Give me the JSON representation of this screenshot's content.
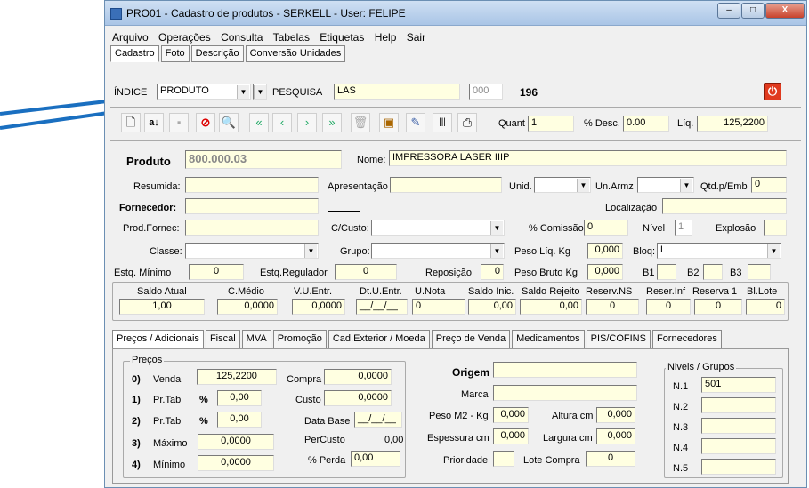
{
  "window": {
    "title": "PRO01 - Cadastro de produtos - SERKELL - User: FELIPE",
    "min": "–",
    "max": "□",
    "close": "X"
  },
  "menu": [
    "Arquivo",
    "Operações",
    "Consulta",
    "Tabelas",
    "Etiquetas",
    "Help",
    "Sair"
  ],
  "tabs_top": [
    "Cadastro",
    "Foto",
    "Descrição",
    "Conversão Unidades"
  ],
  "search": {
    "indice_label": "ÍNDICE",
    "indice_value": "PRODUTO",
    "pesquisa_label": "PESQUISA",
    "pesquisa_value": "LAS",
    "count_field": "000",
    "count": "196"
  },
  "toolbar": {
    "quant_label": "Quant",
    "quant_value": "1",
    "desc_label": "% Desc.",
    "desc_value": "0.00",
    "liq_label": "Líq.",
    "liq_value": "125,2200"
  },
  "product": {
    "produto_label": "Produto",
    "produto_value": "800.000.03",
    "nome_label": "Nome:",
    "nome_value": "IMPRESSORA LASER IIIP",
    "resumida_label": "Resumida:",
    "apresentacao_label": "Apresentação",
    "unid_label": "Unid.",
    "unarmz_label": "Un.Armz",
    "qtdemb_label": "Qtd.p/Emb",
    "qtdemb_value": "0",
    "fornecedor_label": "Fornecedor:",
    "localizacao_label": "Localização",
    "prodfornec_label": "Prod.Fornec:",
    "ccusto_label": "C/Custo:",
    "comissao_label": "% Comissão",
    "comissao_value": "0",
    "nivel_label": "Nível",
    "nivel_value": "1",
    "explosao_label": "Explosão",
    "classe_label": "Classe:",
    "grupo_label": "Grupo:",
    "pesoliq_label": "Peso Líq. Kg",
    "pesoliq_value": "0,000",
    "bloq_label": "Bloq:",
    "bloq_value": "L",
    "estqmin_label": "Estq. Mínimo",
    "estqmin_value": "0",
    "estqreg_label": "Estq.Regulador",
    "estqreg_value": "0",
    "reposicao_label": "Reposição",
    "reposicao_value": "0",
    "pesobruto_label": "Peso Bruto Kg",
    "pesobruto_value": "0,000",
    "b1": "B1",
    "b2": "B2",
    "b3": "B3"
  },
  "stock": {
    "headers": [
      "Saldo Atual",
      "C.Médio",
      "V.U.Entr.",
      "Dt.U.Entr.",
      "U.Nota",
      "Saldo Inic.",
      "Saldo Rejeito",
      "Reserv.NS",
      "Reser.Inf",
      "Reserva 1",
      "Bl.Lote"
    ],
    "values": [
      "1,00",
      "0,0000",
      "0,0000",
      "__/__/__",
      "0",
      "0,00",
      "0,00",
      "0",
      "0",
      "0",
      "0"
    ]
  },
  "tabs_bottom": [
    "Preços / Adicionais",
    "Fiscal",
    "MVA",
    "Promoção",
    "Cad.Exterior / Moeda",
    "Preço de Venda",
    "Medicamentos",
    "PIS/COFINS",
    "Fornecedores"
  ],
  "precos": {
    "group": "Preços",
    "rows": [
      {
        "num": "0)",
        "label": "Venda",
        "pct": "",
        "value": "125,2200"
      },
      {
        "num": "1)",
        "label": "Pr.Tab",
        "pct": "%",
        "value": "0,00"
      },
      {
        "num": "2)",
        "label": "Pr.Tab",
        "pct": "%",
        "value": "0,00"
      },
      {
        "num": "3)",
        "label": "Máximo",
        "pct": "",
        "value": "0,0000"
      },
      {
        "num": "4)",
        "label": "Mínimo",
        "pct": "",
        "value": "0,0000"
      }
    ],
    "compra_label": "Compra",
    "compra_value": "0,0000",
    "custo_label": "Custo",
    "custo_value": "0,0000",
    "database_label": "Data Base",
    "database_value": "__/__/__",
    "percusto_label": "PerCusto",
    "percusto_value": "0,00",
    "perda_label": "% Perda",
    "perda_value": "0,00"
  },
  "origem": {
    "origem_label": "Origem",
    "marca_label": "Marca",
    "pesom2_label": "Peso M2 - Kg",
    "pesom2_value": "0,000",
    "altura_label": "Altura cm",
    "altura_value": "0,000",
    "espessura_label": "Espessura cm",
    "espessura_value": "0,000",
    "largura_label": "Largura cm",
    "largura_value": "0,000",
    "prioridade_label": "Prioridade",
    "lotecompra_label": "Lote Compra",
    "lotecompra_value": "0"
  },
  "niveis": {
    "group": "Niveis / Grupos",
    "labels": [
      "N.1",
      "N.2",
      "N.3",
      "N.4",
      "N.5"
    ],
    "n1_value": "501"
  },
  "colors": {
    "field": "#ffffe1",
    "arrow": "#1a6fc0",
    "power": "#e03a1e"
  }
}
